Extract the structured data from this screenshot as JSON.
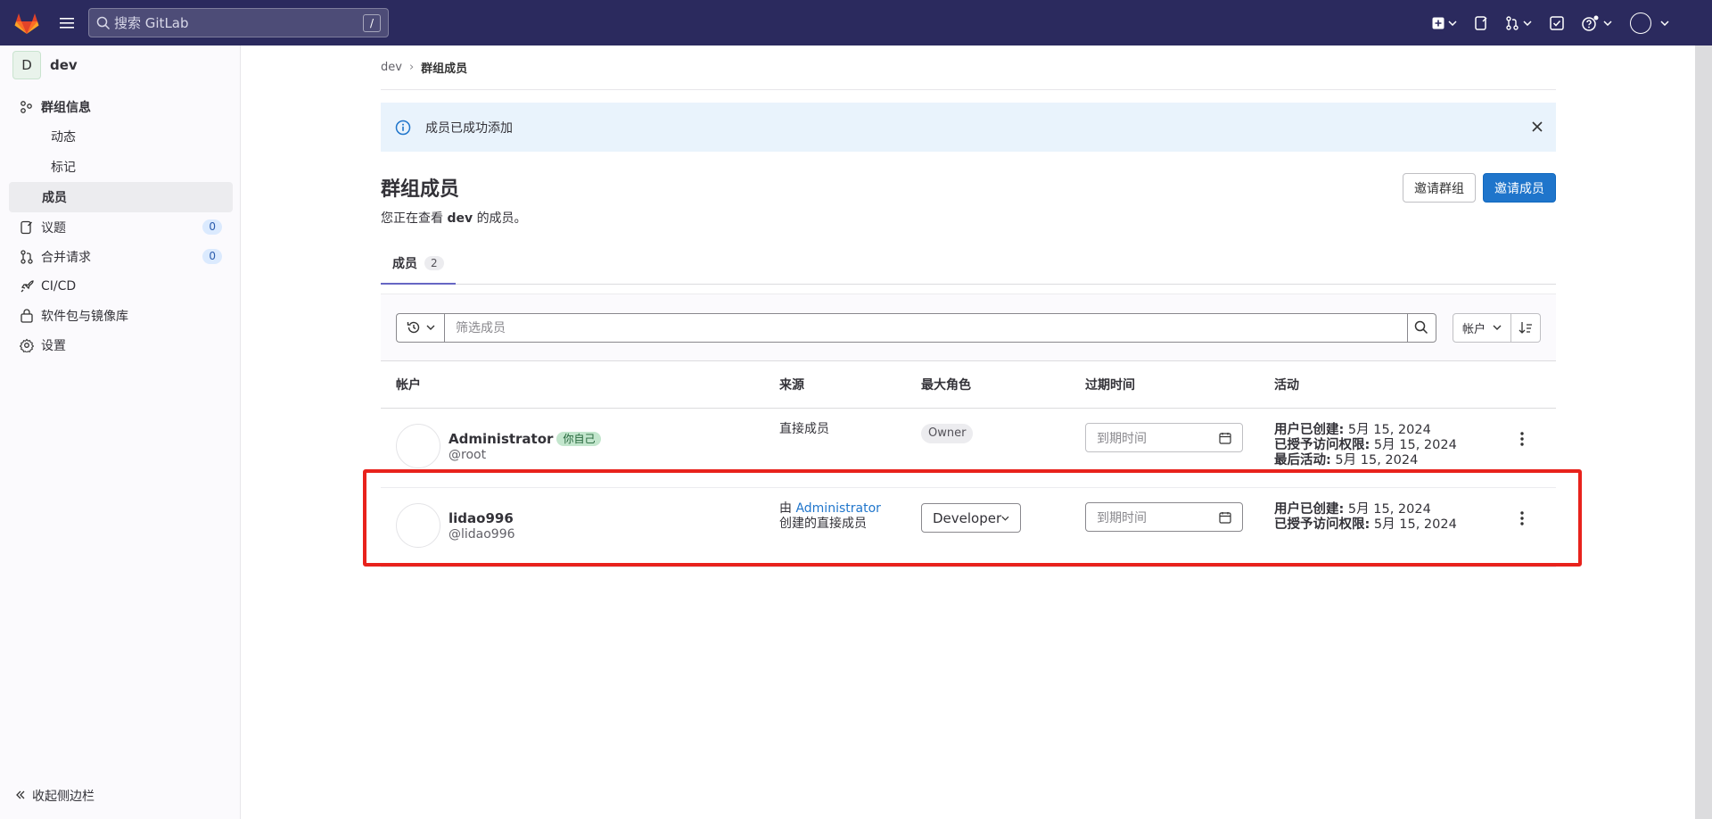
{
  "topbar": {
    "search_placeholder": "搜索 GitLab",
    "search_shortcut": "/"
  },
  "sidebar": {
    "context_avatar": "D",
    "context_name": "dev",
    "items": [
      {
        "label": "群组信息",
        "icon": "group-icon"
      },
      {
        "label": "动态"
      },
      {
        "label": "标记"
      },
      {
        "label": "成员"
      },
      {
        "label": "议题",
        "icon": "issues-icon",
        "count": "0"
      },
      {
        "label": "合并请求",
        "icon": "merge-request-icon",
        "count": "0"
      },
      {
        "label": "CI/CD",
        "icon": "rocket-icon"
      },
      {
        "label": "软件包与镜像库",
        "icon": "package-icon"
      },
      {
        "label": "设置",
        "icon": "settings-icon"
      }
    ],
    "collapse_label": "收起侧边栏"
  },
  "breadcrumb": {
    "parent": "dev",
    "current": "群组成员"
  },
  "alert": {
    "message": "成员已成功添加"
  },
  "header": {
    "title": "群组成员",
    "subtitle_prefix": "您正在查看",
    "subtitle_group": "dev",
    "subtitle_suffix": "的成员。",
    "invite_group": "邀请群组",
    "invite_member": "邀请成员"
  },
  "tabs": [
    {
      "label": "成员",
      "count": "2"
    }
  ],
  "filter": {
    "placeholder": "筛选成员",
    "sort_field": "帐户"
  },
  "table": {
    "columns": [
      "帐户",
      "来源",
      "最大角色",
      "过期时间",
      "活动"
    ],
    "rows": [
      {
        "name": "Administrator",
        "you_badge": "你自己",
        "username": "@root",
        "source": "直接成员",
        "role": "Owner",
        "expiry_placeholder": "到期时间",
        "activity": [
          {
            "label": "用户已创建:",
            "value": "5月 15, 2024"
          },
          {
            "label": "已授予访问权限:",
            "value": "5月 15, 2024"
          },
          {
            "label": "最后活动:",
            "value": "5月 15, 2024"
          }
        ]
      },
      {
        "name": "lidao996",
        "username": "@lidao996",
        "source_prefix": "由",
        "source_link": "Administrator",
        "source_suffix": "创建的直接成员",
        "role": "Developer",
        "expiry_placeholder": "到期时间",
        "activity": [
          {
            "label": "用户已创建:",
            "value": "5月 15, 2024"
          },
          {
            "label": "已授予访问权限:",
            "value": "5月 15, 2024"
          }
        ]
      }
    ]
  },
  "colors": {
    "topbar": "#2b2a5e",
    "primary": "#1f75cb",
    "highlight": "#e8221c"
  }
}
